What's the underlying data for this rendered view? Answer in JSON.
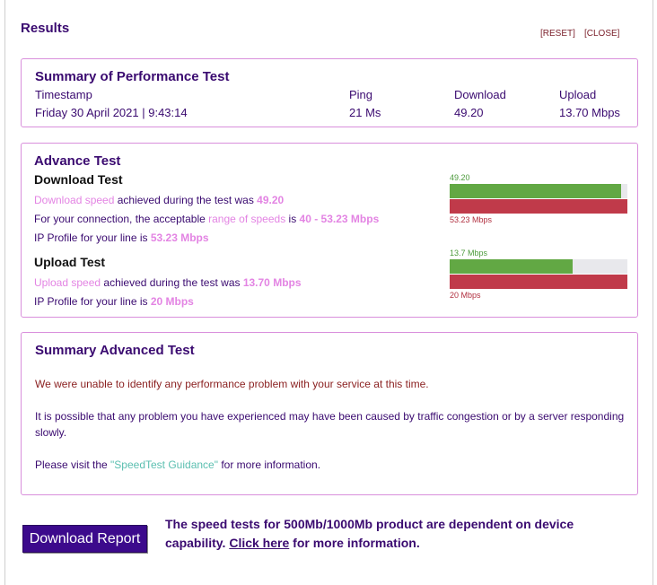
{
  "header": {
    "title": "Results",
    "reset_label": "[RESET]",
    "close_label": "[CLOSE]"
  },
  "summary": {
    "title": "Summary of Performance Test",
    "columns": [
      {
        "head": "Timestamp",
        "value": "Friday 30 April 2021 | 9:43:14"
      },
      {
        "head": "Ping",
        "value": "21 Ms"
      },
      {
        "head": "Download",
        "value": "49.20"
      },
      {
        "head": "Upload",
        "value": "13.70 Mbps"
      }
    ]
  },
  "advance": {
    "title": "Advance Test",
    "download": {
      "heading": "Download Test",
      "l1_link": "Download speed",
      "l1_text": " achieved during the test was ",
      "l1_value": "49.20",
      "l2_text": "For your connection, the acceptable ",
      "l2_link": "range of speeds",
      "l2_mid": " is ",
      "l2_value": "40 - 53.23 Mbps",
      "l3_text": "IP Profile for your line is ",
      "l3_value": "53.23 Mbps",
      "bar_top_label": "49.20",
      "bar_bottom_label": "53.23 Mbps",
      "achieved_fraction": 0.966
    },
    "upload": {
      "heading": "Upload Test",
      "l1_link": "Upload speed",
      "l1_text": " achieved during the test was ",
      "l1_value": "13.70 Mbps",
      "l2_text": "IP Profile for your line is ",
      "l2_value": "20 Mbps",
      "bar_top_label": "13.7 Mbps",
      "bar_bottom_label": "20 Mbps",
      "achieved_fraction": 0.69
    }
  },
  "summary_adv": {
    "title": "Summary Advanced Test",
    "p1": "We were unable to identify any performance problem with your service at this time.",
    "p2": "It is possible that any problem you have experienced may have been caused by traffic congestion or by a server responding slowly.",
    "p3_pre": "Please visit the ",
    "p3_link": "\"SpeedTest Guidance\"",
    "p3_post": " for more information."
  },
  "footer": {
    "download_report": "Download Report",
    "note_pre": "The speed tests for 500Mb/1000Mb product are dependent on device capability. ",
    "note_link": "Click here",
    "note_post": " for more information."
  },
  "colors": {
    "accent": "#3a0a70",
    "highlight": "#e384e3",
    "bar_green": "#62a844",
    "bar_red": "#c03a4a",
    "panel_border": "#d98fdc",
    "link_teal": "#5bbfb0"
  }
}
